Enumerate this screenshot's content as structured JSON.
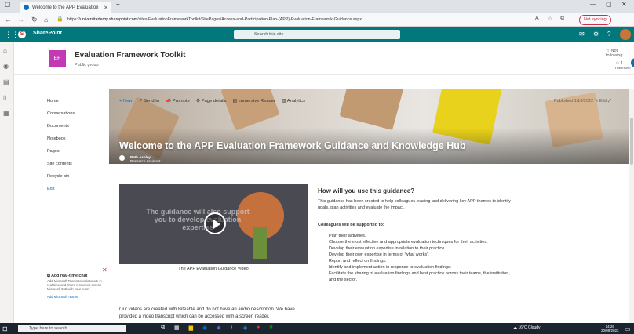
{
  "browser": {
    "tab_title": "Welcome to the APP Evaluation",
    "new_tab": "+",
    "url_prefix": "https://",
    "url_host": "universitederby.sharepoint.com",
    "url_path": "/sites/EvaluationFrameworkToolkit/SitePages/Access-and-Participation-Plan-(APP)-Evaluation-Framework-Guidance.aspx",
    "sync_label": "Not syncing"
  },
  "sharepoint": {
    "app_name": "SharePoint",
    "search_placeholder": "Search this site"
  },
  "site": {
    "logo_initials": "EF",
    "name": "Evaluation Framework Toolkit",
    "subtitle": "Public group",
    "follow_label": "Not following",
    "members_label": "1 member",
    "chat_badge": "5"
  },
  "left_nav": {
    "items": [
      "Home",
      "Conversations",
      "Documents",
      "Notebook",
      "Pages",
      "Site contents",
      "Recycle bin"
    ],
    "edit_label": "Edit"
  },
  "command_bar": {
    "new_label": "+ New",
    "send_label": "Send to",
    "promote_label": "Promote",
    "details_label": "Page details",
    "reader_label": "Immersive Reader",
    "analytics_label": "Analytics",
    "published_label": "Published 1/10/2022",
    "edit_label": "Edit"
  },
  "hero": {
    "title": "Welcome to the APP Evaluation Framework Guidance and Knowledge Hub",
    "author_name": "Beth Ashley",
    "author_role": "Research Assistant"
  },
  "video": {
    "overlay_text": "The guidance will also support you to develop evaluation expertise",
    "caption": "The APP Evaluation Guidance Video",
    "note": "Our videos are created with Biteable and do not have an audio description. We have provided a video transcript which can be accessed with a screen reader."
  },
  "guidance": {
    "heading": "How will you use this guidance?",
    "intro": "This guidance has been created to help colleagues leading and delivering key APP themes to identify goals, plan activities and evaluate the impact.",
    "supported_heading": "Colleagues will be supported to:",
    "bullets": [
      "Plan their activities.",
      "Choose the most effective and appropriate evaluation techniques for their activities.",
      "Develop their evaluation expertise in relation to their practice.",
      "Develop their own expertise in terms of 'what works'.",
      "Report and reflect on findings.",
      "Identify and implement action in response to evaluation findings.",
      "Facilitate the sharing of evaluation findings and best practice across their teams, the institution, and the sector."
    ]
  },
  "chat_panel": {
    "title": "Add real-time chat",
    "body": "Add Microsoft Teams to collaborate in real time and share resources across Microsoft 365 with your team.",
    "link": "Add Microsoft Teams"
  },
  "taskbar": {
    "search_placeholder": "Type here to search",
    "weather": "16°C Cloudy",
    "time": "14:26",
    "date": "20/09/2022"
  },
  "colors": {
    "suite_bar": "#03787c",
    "site_logo": "#c239b3",
    "accent": "#0f6cbd"
  }
}
